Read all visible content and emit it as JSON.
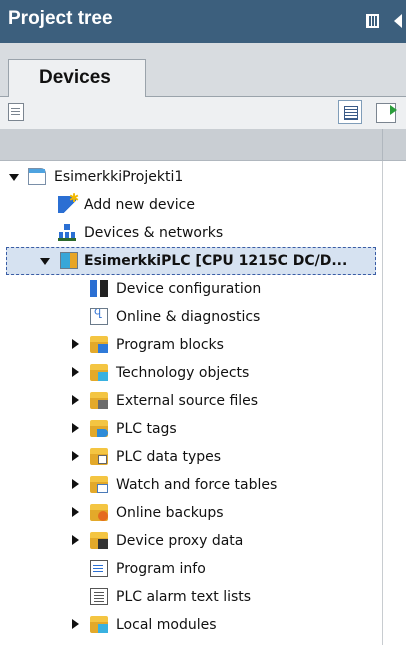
{
  "panel": {
    "title": "Project tree",
    "pin_icon": "pin-panel-icon",
    "collapse_icon": "collapse-left-icon"
  },
  "tabs": [
    {
      "label": "Devices"
    }
  ],
  "toolbar": {
    "left_icon": "add-item-icon",
    "view_icon": "overview-icon",
    "right_icon": "export-icon"
  },
  "tree": {
    "items": [
      {
        "label": "EsimerkkiProjekti1",
        "icon": "project-icon",
        "expander": "expanded"
      },
      {
        "label": "Add new device",
        "icon": "add-device-icon",
        "expander": "none"
      },
      {
        "label": "Devices & networks",
        "icon": "network-icon",
        "expander": "none"
      },
      {
        "label": "EsimerkkiPLC [CPU 1215C DC/D...",
        "icon": "plc-icon",
        "expander": "expanded",
        "selected": true
      },
      {
        "label": "Device configuration",
        "icon": "device-config-icon",
        "expander": "none"
      },
      {
        "label": "Online & diagnostics",
        "icon": "online-diagnostics-icon",
        "expander": "none"
      },
      {
        "label": "Program blocks",
        "icon": "program-blocks-folder-icon",
        "expander": "collapsed"
      },
      {
        "label": "Technology objects",
        "icon": "technology-objects-folder-icon",
        "expander": "collapsed"
      },
      {
        "label": "External source files",
        "icon": "external-source-folder-icon",
        "expander": "collapsed"
      },
      {
        "label": "PLC tags",
        "icon": "plc-tags-folder-icon",
        "expander": "collapsed"
      },
      {
        "label": "PLC data types",
        "icon": "plc-data-types-folder-icon",
        "expander": "collapsed"
      },
      {
        "label": "Watch and force tables",
        "icon": "watch-tables-folder-icon",
        "expander": "collapsed"
      },
      {
        "label": "Online backups",
        "icon": "online-backups-folder-icon",
        "expander": "collapsed"
      },
      {
        "label": "Device proxy data",
        "icon": "device-proxy-folder-icon",
        "expander": "collapsed"
      },
      {
        "label": "Program info",
        "icon": "program-info-icon",
        "expander": "none"
      },
      {
        "label": "PLC alarm text lists",
        "icon": "alarm-text-icon",
        "expander": "none"
      },
      {
        "label": "Local modules",
        "icon": "local-modules-folder-icon",
        "expander": "collapsed"
      }
    ]
  }
}
